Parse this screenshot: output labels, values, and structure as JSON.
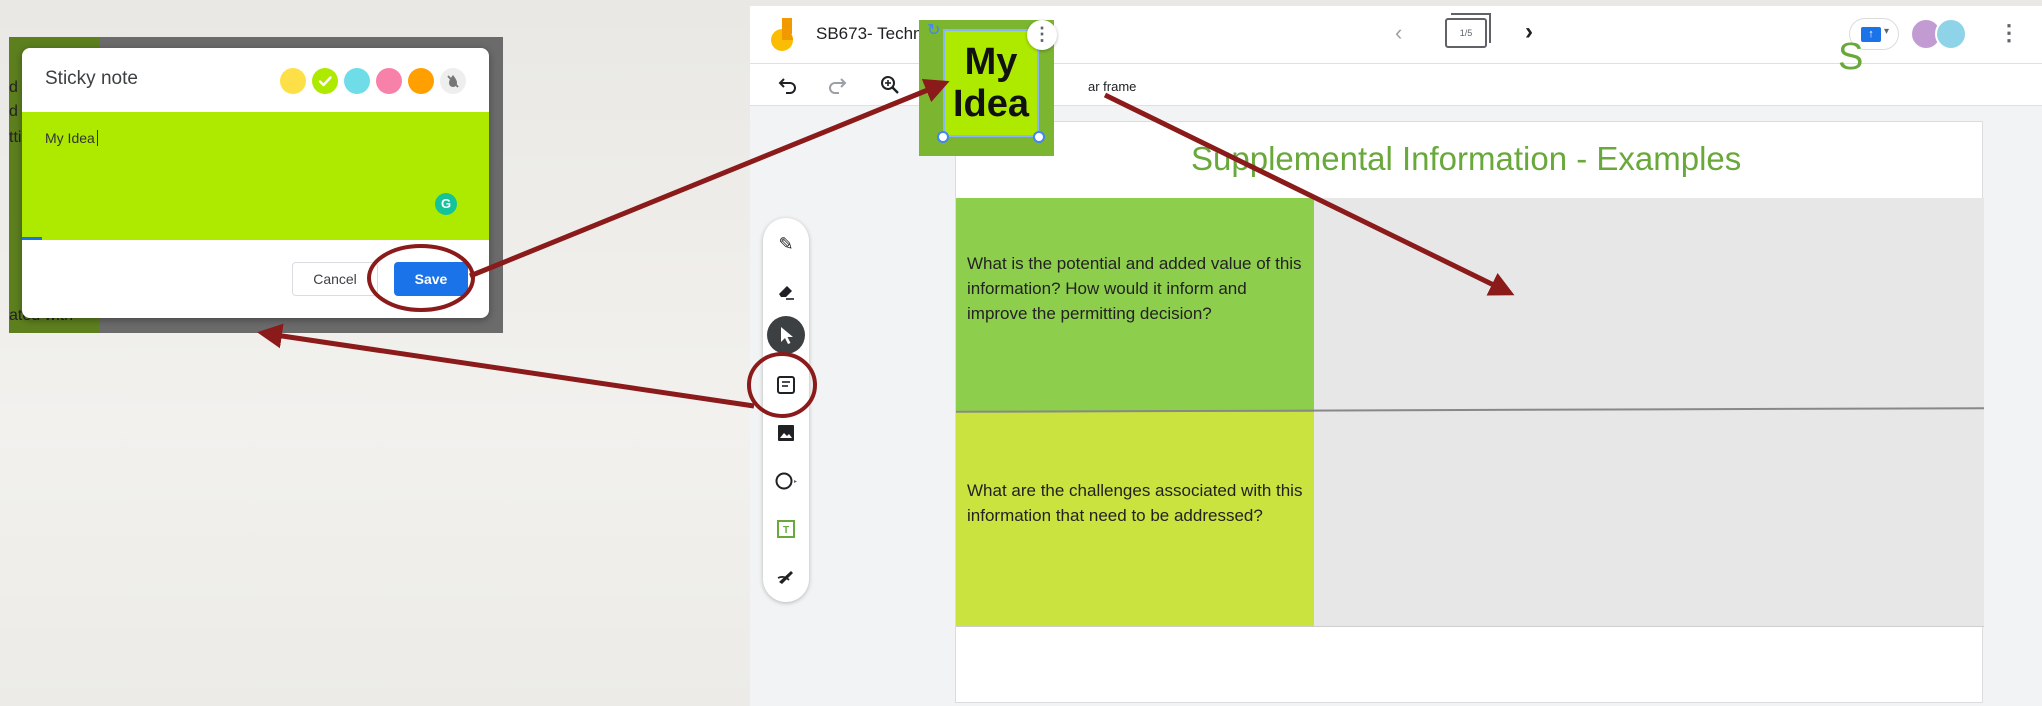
{
  "dialog": {
    "background_peek": [
      "d",
      "d",
      "tti",
      "ated with"
    ],
    "title": "Sticky note",
    "colors": [
      {
        "name": "yellow",
        "hex": "#fde047",
        "selected": false
      },
      {
        "name": "lime",
        "hex": "#adea00",
        "selected": true
      },
      {
        "name": "cyan",
        "hex": "#6fdde8",
        "selected": false
      },
      {
        "name": "pink",
        "hex": "#f781a8",
        "selected": false
      },
      {
        "name": "orange",
        "hex": "#ff9f00",
        "selected": false
      }
    ],
    "note_text": "My Idea",
    "cancel_label": "Cancel",
    "save_label": "Save"
  },
  "app": {
    "title": "SB673- Techn",
    "frame_counter": "1/5",
    "toolbar": {
      "clear_frame_label": "ar frame"
    },
    "sticky": {
      "line1": "My",
      "line2": "Idea"
    },
    "peek_letter": "S",
    "slide": {
      "heading": "Supplemental Information - Examples",
      "q1": "What is the potential and added value of this information? How would it inform and improve the permitting decision?",
      "q2": "What are the challenges associated with this information that need to be addressed?"
    }
  },
  "annotation_color": "#8b1a1a"
}
